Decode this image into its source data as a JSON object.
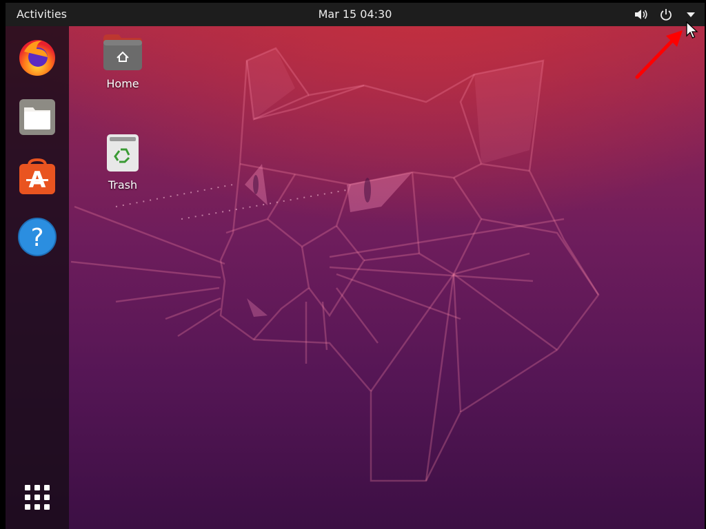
{
  "topbar": {
    "activities_label": "Activities",
    "clock": "Mar 15  04:30",
    "tray": {
      "volume_icon": "volume-icon",
      "power_icon": "power-icon",
      "menu_icon": "chevron-down-icon"
    }
  },
  "dock": {
    "items": [
      {
        "name": "firefox",
        "icon": "firefox-icon"
      },
      {
        "name": "files",
        "icon": "files-icon"
      },
      {
        "name": "software",
        "icon": "software-store-icon",
        "glyph": "A"
      },
      {
        "name": "help",
        "icon": "help-icon",
        "glyph": "?"
      }
    ],
    "show_apps_icon": "app-grid-icon"
  },
  "desktop": {
    "icons": [
      {
        "label": "Home",
        "icon": "home-folder-icon"
      },
      {
        "label": "Trash",
        "icon": "trash-icon"
      }
    ]
  },
  "colors": {
    "topbar": "#1d1d1d",
    "wallpaper_top": "#c6303d",
    "wallpaper_bottom": "#3c0f44",
    "dock": "#180c18",
    "annotation_arrow": "#ff0000",
    "software_orange": "#e95420",
    "help_blue": "#2b8ee0"
  }
}
